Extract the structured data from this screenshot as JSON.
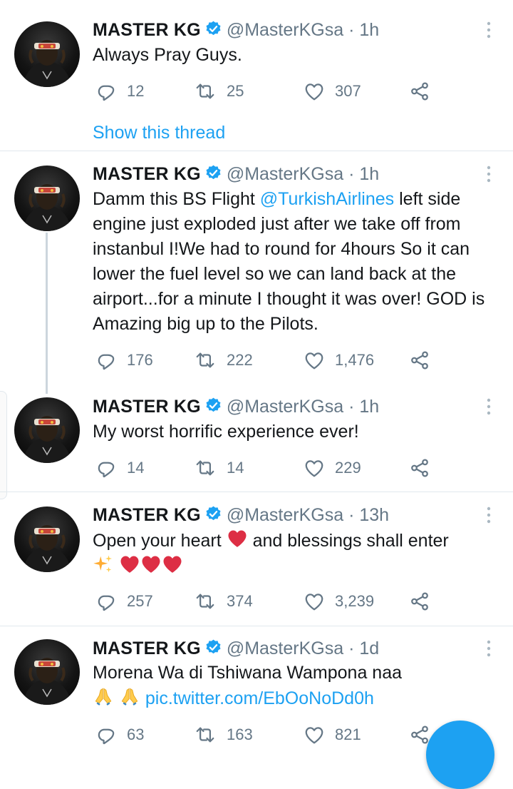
{
  "tweets": [
    {
      "name": "MASTER KG",
      "handle": "@MasterKGsa",
      "separator": "·",
      "time": "1h",
      "text": "Always Pray Guys.",
      "replies": "12",
      "retweets": "25",
      "likes": "307",
      "show_thread": "Show this thread"
    },
    {
      "name": "MASTER KG",
      "handle": "@MasterKGsa",
      "separator": "·",
      "time": "1h",
      "text_before": "Damm this BS Flight ",
      "mention": "@TurkishAirlines",
      "text_after": " left side engine just exploded just after we take off from instanbul I!We had to round for 4hours So it can lower the fuel level so we can land back at the airport...for a minute I thought it was over! GOD is Amazing big up to the Pilots.",
      "replies": "176",
      "retweets": "222",
      "likes": "1,476"
    },
    {
      "name": "MASTER KG",
      "handle": "@MasterKGsa",
      "separator": "·",
      "time": "1h",
      "text": "My worst horrific experience ever!",
      "replies": "14",
      "retweets": "14",
      "likes": "229"
    },
    {
      "name": "MASTER KG",
      "handle": "@MasterKGsa",
      "separator": "·",
      "time": "13h",
      "text_before": "Open your heart ",
      "text_after": "  and blessings shall enter",
      "replies": "257",
      "retweets": "374",
      "likes": "3,239"
    },
    {
      "name": "MASTER KG",
      "handle": "@MasterKGsa",
      "separator": "·",
      "time": "1d",
      "text": "Morena Wa di Tshiwana Wampona naa",
      "link": "pic.twitter.com/EbOoNoDd0h",
      "replies": "63",
      "retweets": "163",
      "likes": "821"
    }
  ],
  "icons": {
    "reply": "reply-icon",
    "retweet": "retweet-icon",
    "like": "like-icon",
    "share": "share-icon",
    "verified": "verified-badge-icon",
    "more": "more-options-icon"
  },
  "colors": {
    "accent": "#1da1f2",
    "secondary_text": "#657786",
    "divider": "#e1e8ed",
    "heart_emoji": "#dd2e44"
  }
}
